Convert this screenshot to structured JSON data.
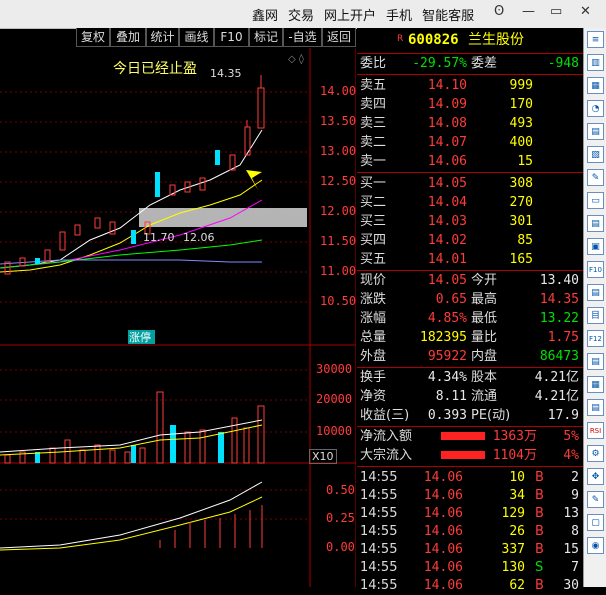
{
  "menu": {
    "items": [
      "鑫网",
      "交易",
      "网上开户",
      "手机",
      "智能客服"
    ],
    "window_buttons": [
      "ʘ",
      "—",
      "▭",
      "✕"
    ]
  },
  "toolbar": {
    "items": [
      "复权",
      "叠加",
      "统计",
      "画线",
      "F10",
      "标记",
      "-自选",
      "返回"
    ]
  },
  "chart": {
    "annotation": "今日已经止盈",
    "high_label": "14.35",
    "low_label1": "11.70",
    "low_label2": "12.06",
    "zt_badge": "涨停",
    "x10": "X10",
    "price_axis": [
      "14.00",
      "13.50",
      "13.00",
      "12.50",
      "12.00",
      "11.50",
      "11.00",
      "10.50"
    ],
    "vol_axis": [
      "30000",
      "20000",
      "10000"
    ],
    "ind_axis": [
      "0.50",
      "0.25",
      "0.00"
    ]
  },
  "stock": {
    "badge": "R",
    "code": "600826",
    "name": "兰生股份"
  },
  "weibi": {
    "label1": "委比",
    "value1": "-29.57%",
    "label2": "委差",
    "value2": "-948"
  },
  "asks": [
    {
      "label": "卖五",
      "price": "14.10",
      "vol": "999"
    },
    {
      "label": "卖四",
      "price": "14.09",
      "vol": "170"
    },
    {
      "label": "卖三",
      "price": "14.08",
      "vol": "493"
    },
    {
      "label": "卖二",
      "price": "14.07",
      "vol": "400"
    },
    {
      "label": "卖一",
      "price": "14.06",
      "vol": "15"
    }
  ],
  "bids": [
    {
      "label": "买一",
      "price": "14.05",
      "vol": "308"
    },
    {
      "label": "买二",
      "price": "14.04",
      "vol": "270"
    },
    {
      "label": "买三",
      "price": "14.03",
      "vol": "301"
    },
    {
      "label": "买四",
      "price": "14.02",
      "vol": "85"
    },
    {
      "label": "买五",
      "price": "14.01",
      "vol": "165"
    }
  ],
  "stats1": [
    {
      "l1": "现价",
      "v1": "14.05",
      "c1": "red",
      "l2": "今开",
      "v2": "13.40",
      "c2": "white"
    },
    {
      "l1": "涨跌",
      "v1": "0.65",
      "c1": "red",
      "l2": "最高",
      "v2": "14.35",
      "c2": "red"
    },
    {
      "l1": "涨幅",
      "v1": "4.85%",
      "c1": "red",
      "l2": "最低",
      "v2": "13.22",
      "c2": "green"
    },
    {
      "l1": "总量",
      "v1": "182395",
      "c1": "yellow",
      "l2": "量比",
      "v2": "1.75",
      "c2": "red"
    },
    {
      "l1": "外盘",
      "v1": "95922",
      "c1": "red",
      "l2": "内盘",
      "v2": "86473",
      "c2": "green"
    }
  ],
  "stats2": [
    {
      "l1": "换手",
      "v1": "4.34%",
      "l2": "股本",
      "v2": "4.21亿"
    },
    {
      "l1": "净资",
      "v1": "8.11",
      "l2": "流通",
      "v2": "4.21亿"
    },
    {
      "l1": "收益(三)",
      "v1": "0.393",
      "l2": "PE(动)",
      "v2": "17.9"
    }
  ],
  "flows": [
    {
      "label": "净流入额",
      "value": "1363万",
      "pct": "5%"
    },
    {
      "label": "大宗流入",
      "value": "1104万",
      "pct": "4%"
    }
  ],
  "ticks": [
    {
      "time": "14:55",
      "price": "14.06",
      "vol": "10",
      "dir": "B",
      "n": "2"
    },
    {
      "time": "14:55",
      "price": "14.06",
      "vol": "34",
      "dir": "B",
      "n": "9"
    },
    {
      "time": "14:55",
      "price": "14.06",
      "vol": "129",
      "dir": "B",
      "n": "13"
    },
    {
      "time": "14:55",
      "price": "14.06",
      "vol": "26",
      "dir": "B",
      "n": "8"
    },
    {
      "time": "14:55",
      "price": "14.06",
      "vol": "337",
      "dir": "B",
      "n": "15"
    },
    {
      "time": "14:55",
      "price": "14.06",
      "vol": "130",
      "dir": "S",
      "n": "7"
    },
    {
      "time": "14:55",
      "price": "14.06",
      "vol": "62",
      "dir": "B",
      "n": "30"
    }
  ],
  "rightbar": {
    "icons": [
      "≡",
      "▥",
      "▦",
      "◔",
      "▤",
      "▧",
      "✎",
      "▭",
      "▤",
      "▣",
      "F10",
      "▤",
      "目",
      "F12",
      "▤",
      "▦",
      "▤",
      "RSI",
      "⚙",
      "✥",
      "✎",
      "▢",
      "◉"
    ]
  }
}
